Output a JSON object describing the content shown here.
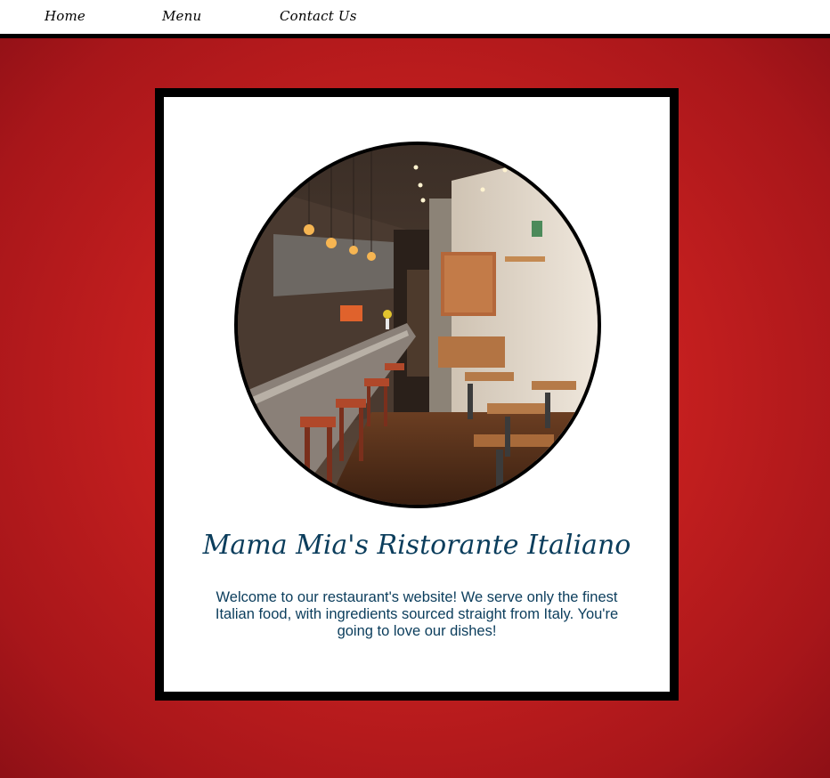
{
  "nav": {
    "home": "Home",
    "menu": "Menu",
    "contact": "Contact Us"
  },
  "main": {
    "photo_alt": "Restaurant interior",
    "title": "Mama Mia's Ristorante Italiano",
    "welcome": "Welcome to our restaurant's website! We serve only the finest Italian food, with ingredients sourced straight from Italy. You're going to love our dishes!"
  },
  "colors": {
    "background": "#c41f1f",
    "accent_text": "#0b3d5c",
    "frame": "#000000"
  }
}
